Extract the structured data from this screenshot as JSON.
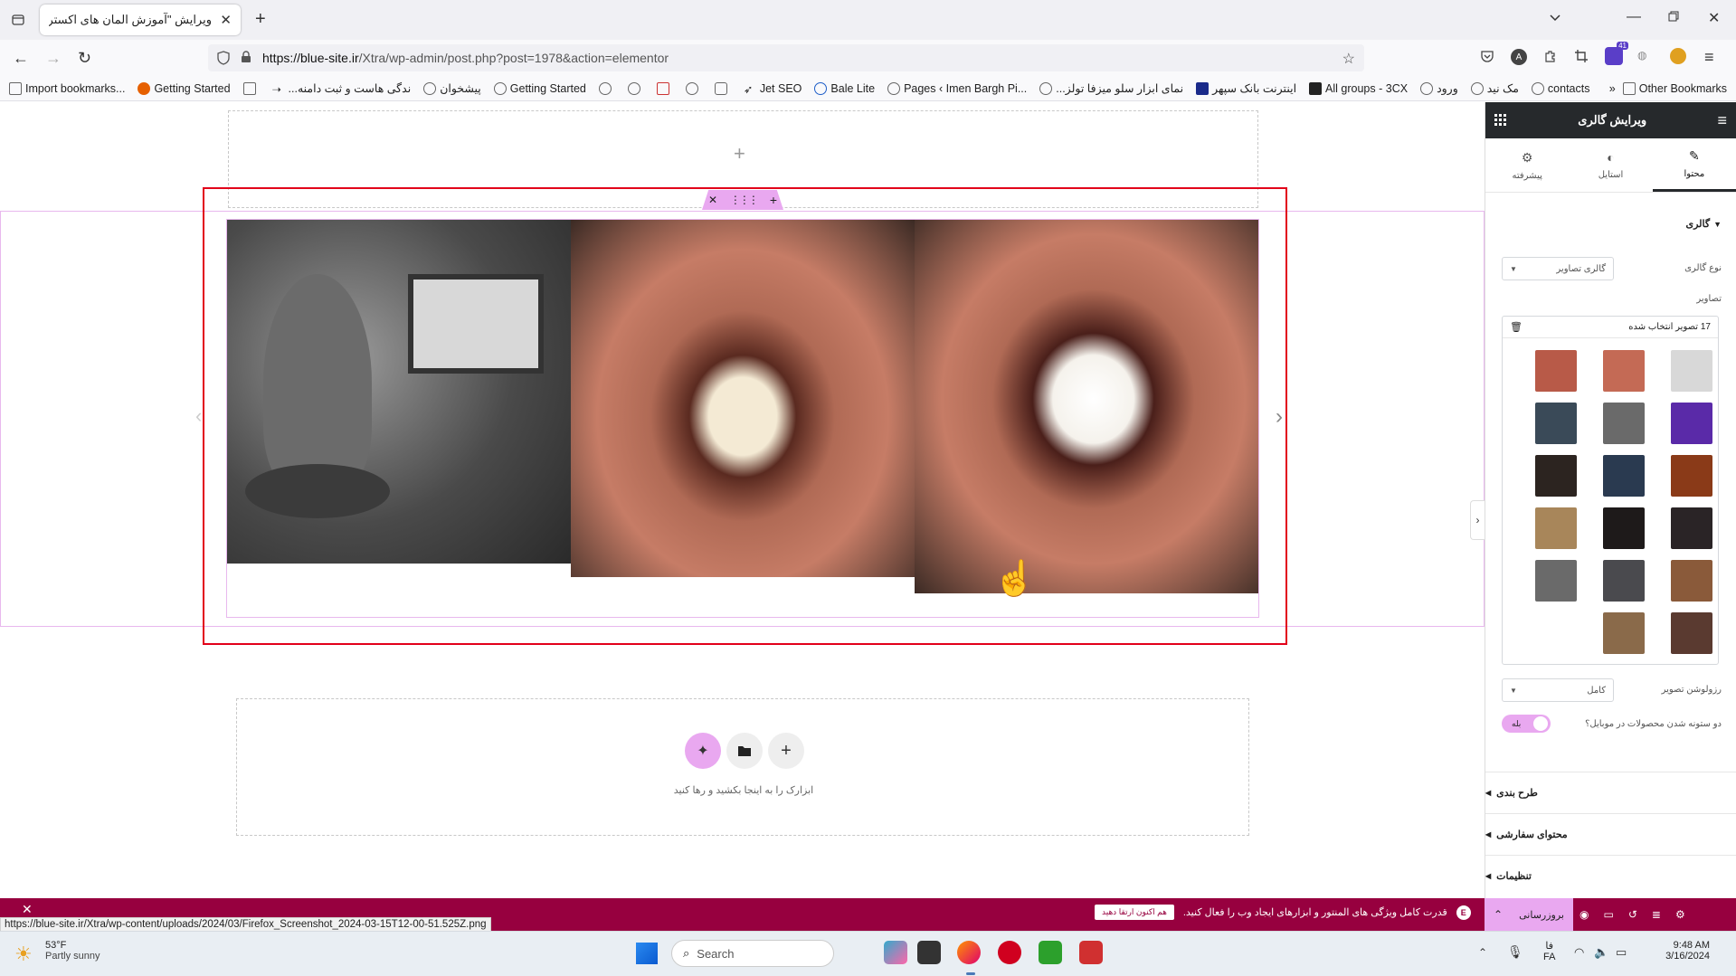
{
  "browser": {
    "tab_title": "ویرایش \"آموزش المان های اکسترا – ...",
    "url_host": "https://blue-site.ir",
    "url_path": "/Xtra/wp-admin/post.php?post=1978&action=elementor",
    "extensions_badge": "41",
    "bookmarks": [
      "Import bookmarks...",
      "Getting Started",
      "...ندگی هاست و ثبت دامنه",
      "پیشخوان",
      "Getting Started",
      "Jet SEO",
      "Bale Lite",
      "Pages ‹ Imen Bargh Pi...",
      "...نمای ابزار سلو میزفا تولز",
      "اینترنت بانک سپهر",
      "All groups - 3CX",
      "ورود",
      "مک نید",
      "contacts"
    ],
    "other_bookmarks": "Other Bookmarks"
  },
  "canvas": {
    "empty_hint": "ابزارک را به اینجا بکشید و رها کنید",
    "add_icon": "+"
  },
  "panel": {
    "title": "ویرایش گالری",
    "tabs": [
      "محتوا",
      "استایل",
      "پیشرفته"
    ],
    "section_gallery": "گالری",
    "gallery_type_label": "نوع گالری",
    "gallery_type_value": "گالری تصاویر",
    "images_label": "تصاویر",
    "images_count": "17 تصویر انتخاب شده",
    "resolution_label": "رزولوشن تصویر",
    "resolution_value": "کامل",
    "mobile_label": "دو ستونه شدن محصولات در موبایل؟",
    "mobile_toggle": "بله",
    "sections": [
      "طرح بندی",
      "محتوای سفارشی",
      "تنظیمات"
    ]
  },
  "footer": {
    "update_button": "بروزرسانی",
    "promo_text": "قدرت کامل ویژگی های المنتور و ابزارهای ایجاد وب را فعال کنید.",
    "promo_button": "هم اکنون ارتقا دهید",
    "status_url": "https://blue-site.ir/Xtra/wp-content/uploads/2024/03/Firefox_Screenshot_2024-03-15T12-00-51.525Z.png"
  },
  "taskbar": {
    "weather_temp": "53°F",
    "weather_desc": "Partly sunny",
    "search_placeholder": "Search",
    "time": "9:48 AM",
    "date": "3/16/2024",
    "lang_top": "فا",
    "lang_bottom": "FA"
  },
  "colors": {
    "accent_pink": "#e9a8f0",
    "selection_red": "#e2001a",
    "promo_bar": "#97003f",
    "panel_header": "#26292c"
  }
}
